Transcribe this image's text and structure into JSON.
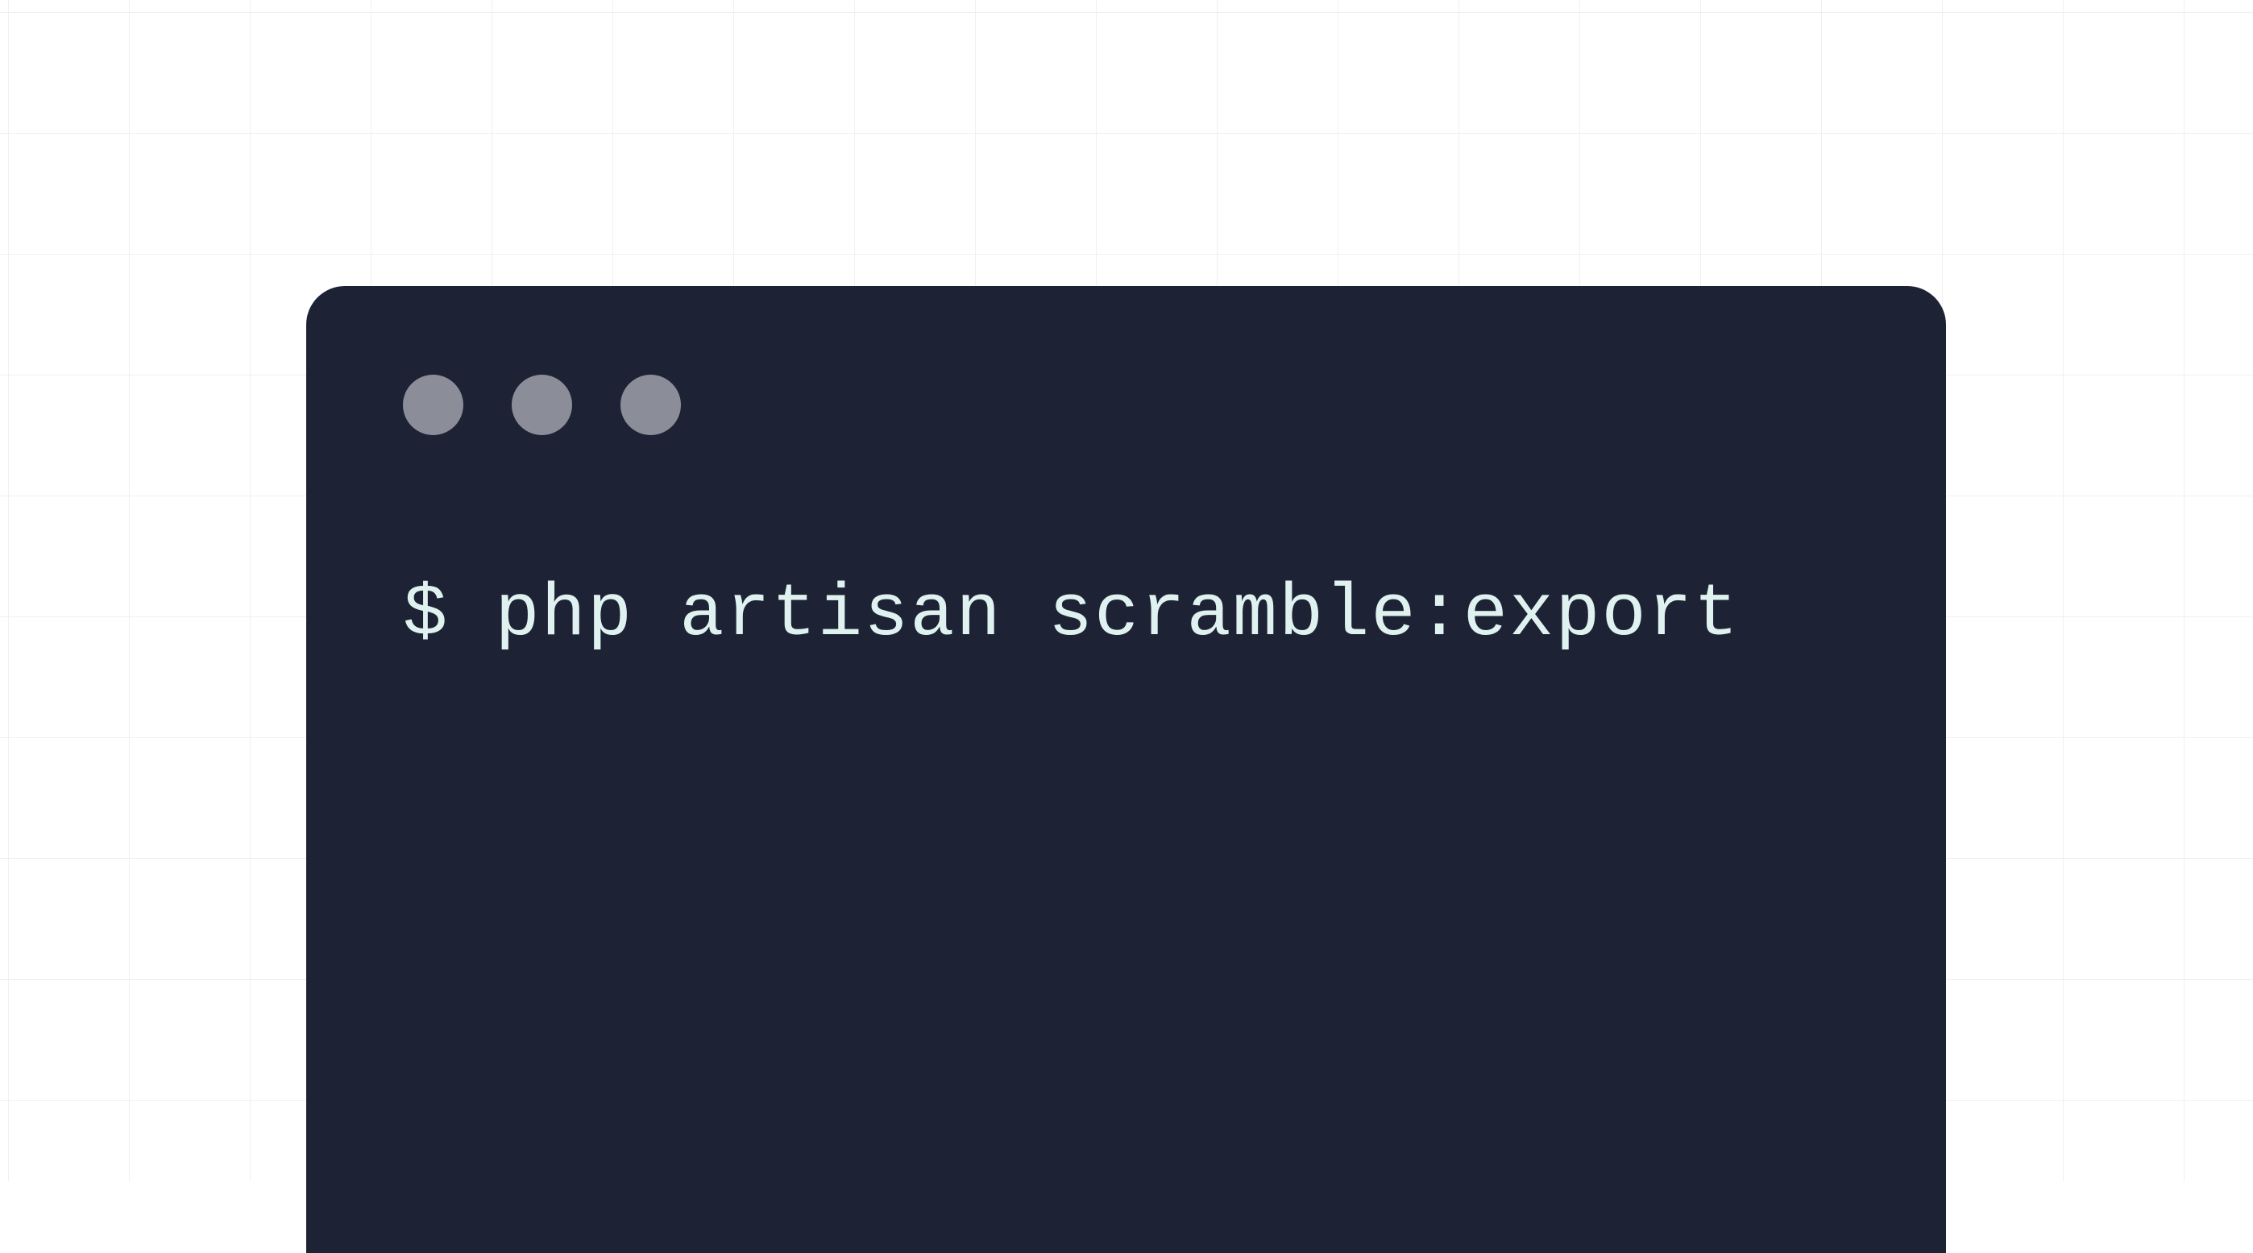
{
  "terminal": {
    "prompt": "$ ",
    "command": "php artisan scramble:export"
  },
  "colors": {
    "terminal_bg": "#1e2235",
    "terminal_text": "#dff2f0",
    "control_dot": "#8b8d99",
    "grid_line": "#f0f0f0"
  }
}
